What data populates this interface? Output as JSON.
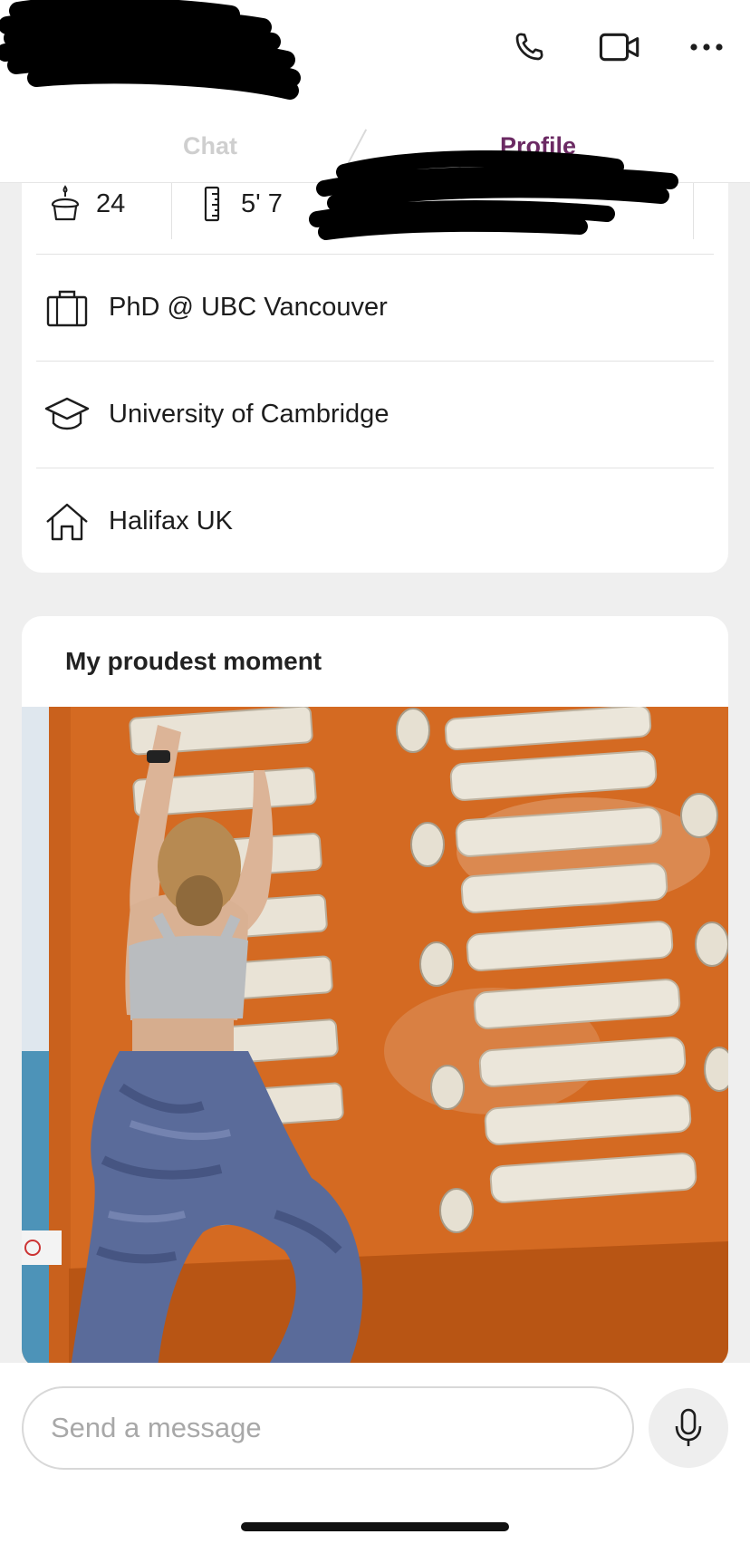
{
  "header": {
    "icons": [
      "phone-icon",
      "video-icon",
      "more-icon"
    ]
  },
  "tabs": [
    {
      "label": "Chat",
      "active": false
    },
    {
      "label": "Profile",
      "active": true
    }
  ],
  "profile": {
    "age": "24",
    "height": "5' 7",
    "job": "PhD @ UBC Vancouver",
    "school": "University of Cambridge",
    "hometown": "Halifax UK"
  },
  "prompt": {
    "title": "My proudest moment"
  },
  "composer": {
    "placeholder": "Send a message"
  },
  "colors": {
    "accent": "#6b2a63",
    "wall_orange": "#d46a22",
    "background": "#efefef"
  }
}
